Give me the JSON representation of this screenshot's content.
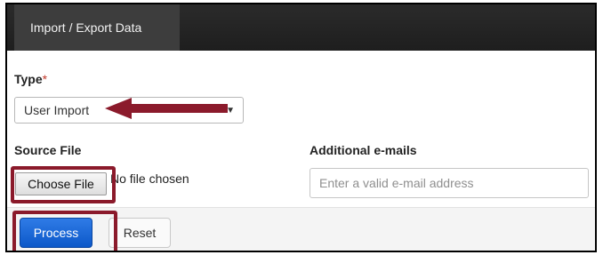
{
  "header": {
    "tab_label": "Import / Export Data"
  },
  "form": {
    "type_label": "Type",
    "type_required_mark": "*",
    "type_selected": "User Import",
    "source_file_label": "Source File",
    "choose_file_label": "Choose File",
    "no_file_text": "No file chosen",
    "emails_label": "Additional e-mails",
    "emails_placeholder": "Enter a valid e-mail address"
  },
  "footer": {
    "process_label": "Process",
    "reset_label": "Reset"
  },
  "icons": {
    "select_caret": "▼",
    "annotation_arrow": "arrow-left-icon",
    "annotation_box": "highlight-box"
  },
  "colors": {
    "annotation": "#8b1a2b",
    "primary_button": "#0c58c9",
    "header_bar": "#222222",
    "required_mark": "#c0392b"
  }
}
